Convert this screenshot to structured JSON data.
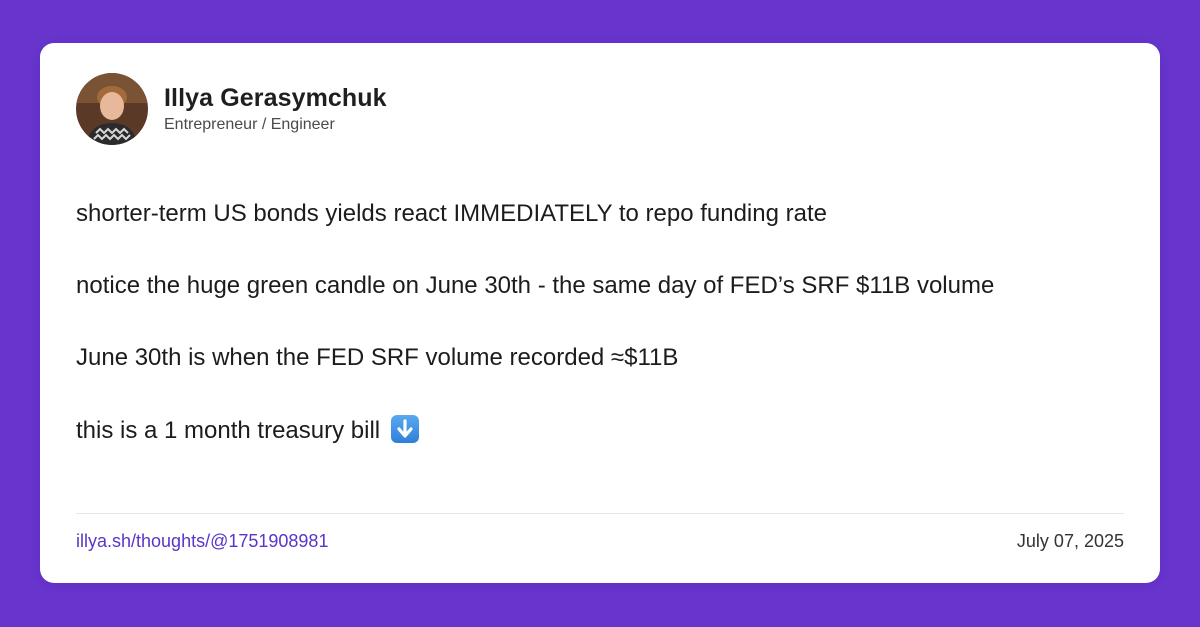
{
  "author": {
    "name": "Illya Gerasymchuk",
    "role": "Entrepreneur / Engineer",
    "avatar_icon": "profile-photo"
  },
  "post": {
    "lines": [
      "shorter-term US bonds yields react IMMEDIATELY to repo funding rate",
      "notice the huge green candle on June 30th - the same day of FED’s SRF $11B volume",
      "June 30th is when the FED SRF volume recorded ≈$11B",
      "this is a 1 month treasury bill"
    ],
    "emoji_icon": "down-arrow-emoji-icon"
  },
  "footer": {
    "link": "illya.sh/thoughts/@1751908981",
    "date": "July 07, 2025"
  },
  "colors": {
    "background": "#6734CC",
    "card": "#ffffff",
    "link": "#5b34c9"
  }
}
